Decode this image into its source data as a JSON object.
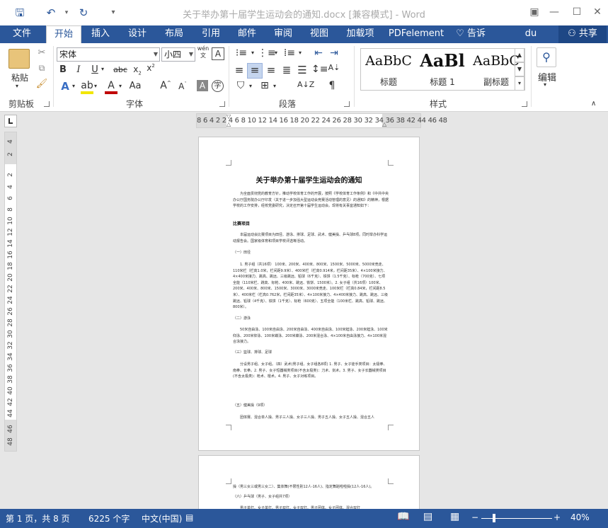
{
  "window": {
    "title": "关于举办第十届学生运动会的通知.docx [兼容模式] - Word"
  },
  "tabs": [
    "文件",
    "开始",
    "插入",
    "设计",
    "布局",
    "引用",
    "邮件",
    "审阅",
    "视图",
    "加载项",
    "PDFelement"
  ],
  "tell_me": "告诉我...",
  "user": "du siming",
  "share": "共享",
  "clipboard": {
    "paste": "粘贴",
    "label": "剪贴板"
  },
  "font": {
    "name": "宋体",
    "size": "小四",
    "wen": "wén",
    "label": "字体"
  },
  "paragraph": {
    "label": "段落"
  },
  "styles": {
    "label": "样式",
    "items": [
      {
        "sample": "AaBbC",
        "name": "标题"
      },
      {
        "sample": "AaBl",
        "name": "标题 1"
      },
      {
        "sample": "AaBbC",
        "name": "副标题"
      }
    ]
  },
  "editing": {
    "label": "编辑"
  },
  "ruler": {
    "h_numbers": "8 6 4 2   2  4  6  8 10 12 14 16 18 20 22 24 26 28 30 32 34 36 38   42 44 46 48",
    "v_numbers": [
      "4",
      "2",
      "2",
      "4",
      "6",
      "8",
      "10",
      "12",
      "14",
      "16",
      "18",
      "20",
      "22",
      "24",
      "26",
      "28",
      "30",
      "32",
      "34",
      "36",
      "38",
      "40",
      "42",
      "44",
      "46",
      "48"
    ]
  },
  "document": {
    "title": "关于举办第十届学生运动会的通知",
    "intro": "为全面贯彻党的教育方针，推动学校体育工作的开展，按照《学校体育工作条例》和《中共中央办公厅国务院办公厅印发〈关于进一步加强大型运动会竞赛活动管理的意见〉的通知》的精神，根据学校的工作安排，经校党委研究，决定召开第十届学生运动会。现将有关事宜通知如下：",
    "section1": "比赛项目",
    "s1_text": "本届运动会比赛项目为田径、游泳、排球、足球、武术、健美操、乒乓球8项。同时举办科学运动报告会。国家级体育和项目学校评选等活动。",
    "sub1": "（一）田径",
    "sub1_text": "1. 男子组（共16项） 100米、200米、400米、800米、1500米、5000米、5000米竞走、110米栏（栏高1.0米，栏间距9.9米）、400米栏（栏高0.914米，栏间距35米）、4×100米接力、4×400米接力、跳高、跳远、三级跳远、铅球（6千克）、铁饼（1.5千克）、标枪（700克）、七项全能（110米栏、跳高、标枪、400米、跳远、铁饼、1500米）。2. 女子组（共16项）100米、200米、400米、800米、1500米、3000米、3000米竞走、100米栏（栏高0.84米，栏间距8.5米）、400米栏（栏高0.762米，栏间距35米）、4×100米接力、4×400米接力、跳高、跳远、三级跳远、铅球（4千克）、铁饼（1千克）、标枪（600克）、五项全能（100米栏、跳高、铅球、跳远、800米）。",
    "sub2": "（二）游泳",
    "sub2_text": "50米自由泳、100米自由泳、200米自由泳、400米自由泳、100米蛙泳、200米蛙泳、100米仰泳、200米仰泳、100米蝶泳、200米蝶泳、200米混合泳、4×100米自由泳接力、4×100米混合泳接力。",
    "sub3": "（三）篮球、排球、足球",
    "sub3_text": "分设男子组、女子组。（四）武术(男子组、女子组各8项) 1. 男子、女子徒手类项目：太极拳、南拳、长拳。2. 男子、女子短器械类项目(不含太极类)：刀术、剑术。3. 男子、女子长器械类项目(不含太极类)：枪术、棍术。4. 男子、女子对练项目。",
    "sub5": "（五）健美操（9项）",
    "sub5_text": "团体赛、混合单人操、男子三人操、女子三人操、男子五人操、女子五人操、混合五人",
    "page2_line1": "操（男三女三或男三女二）、集体舞(不限性别12人-16人)、指定舞蹈啦啦操(12人-16人)。",
    "page2_line2": "（六）乒乓球（男子、女子组共7项）",
    "page2_line3": "男子单打、女子单打、男子双打、女子双打、男子团体、女子团体、混合双打"
  },
  "status": {
    "page": "第 1 页，共 8 页",
    "words": "6225 个字",
    "lang": "中文(中国)",
    "zoom": "40%"
  }
}
